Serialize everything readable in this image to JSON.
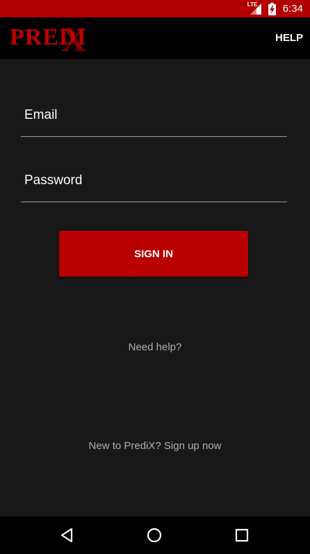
{
  "status_bar": {
    "network_label": "LTE",
    "time": "6:34",
    "icons": [
      "lte-signal-icon",
      "battery-charging-icon"
    ]
  },
  "app_bar": {
    "logo_text": "PREDI",
    "logo_x": "X",
    "help_label": "HELP"
  },
  "login_form": {
    "email_placeholder": "Email",
    "email_value": "",
    "password_placeholder": "Password",
    "password_value": "",
    "signin_label": "SIGN IN"
  },
  "links": {
    "need_help": "Need help?",
    "signup": "New to PrediX? Sign up now"
  },
  "nav_bar": {
    "icons": [
      "back-icon",
      "home-icon",
      "recents-icon"
    ]
  },
  "colors": {
    "accent": "#b80000",
    "status_bar": "#b00000",
    "background": "#181818",
    "app_bar": "#000000",
    "secondary_text": "#b0b0b0"
  }
}
